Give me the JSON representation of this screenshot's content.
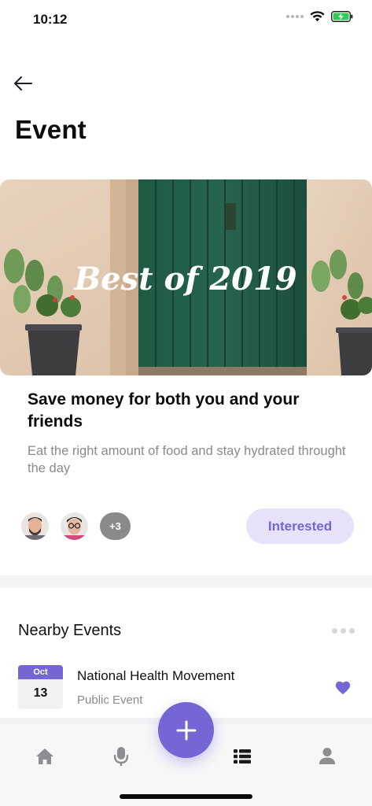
{
  "status_bar": {
    "time": "10:12",
    "icons": [
      "signal-dots-icon",
      "wifi-icon",
      "battery-charging-icon"
    ],
    "battery_color": "#34c759"
  },
  "header": {
    "back_icon": "arrow-left-icon",
    "title": "Event"
  },
  "featured_event": {
    "image_caption": "Best of 2019",
    "title": "Save money for both you and your friends",
    "description": "Eat the right amount of food and stay hydrated throught the day",
    "attendees": {
      "avatars": [
        "avatar-man-beard",
        "avatar-man-glasses"
      ],
      "more_label": "+3"
    },
    "interested_label": "Interested"
  },
  "nearby": {
    "heading": "Nearby Events",
    "more_icon": "more-dots-icon",
    "events": [
      {
        "month": "Oct",
        "day": "13",
        "title": "National Health Movement",
        "subtitle": "Public Event",
        "favorited": true
      }
    ]
  },
  "tab_bar": {
    "tabs": [
      {
        "name": "home",
        "icon": "home-icon",
        "active": false
      },
      {
        "name": "microphone",
        "icon": "microphone-icon",
        "active": false
      },
      {
        "name": "add",
        "icon": "plus-icon",
        "active": false
      },
      {
        "name": "list",
        "icon": "list-icon",
        "active": true
      },
      {
        "name": "profile",
        "icon": "user-icon",
        "active": false
      }
    ]
  },
  "colors": {
    "accent": "#7466d5",
    "accent_light": "#e7e2fa",
    "text_primary": "#111111",
    "text_secondary": "#8a8a8a",
    "icon_inactive": "#8d8d92",
    "icon_active": "#1b1b1b"
  }
}
